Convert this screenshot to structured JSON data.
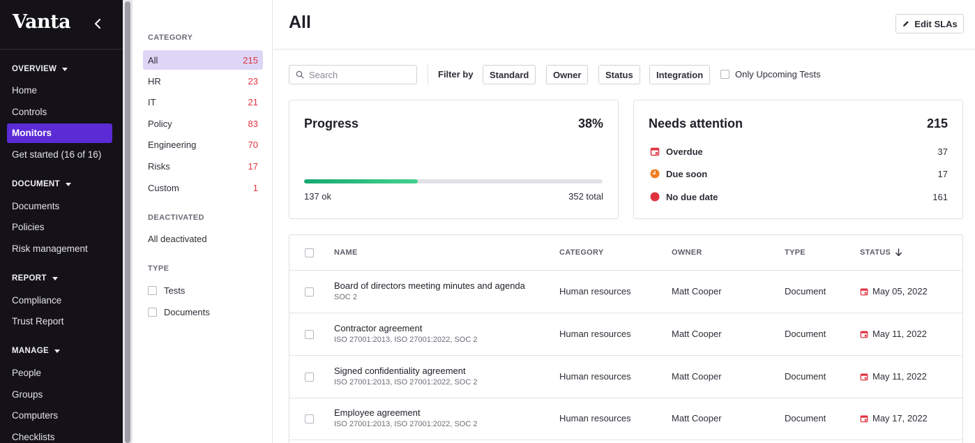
{
  "nav": {
    "brand": "Vanta",
    "sections": [
      {
        "label": "OVERVIEW",
        "items": [
          "Home",
          "Controls",
          "Monitors",
          "Get started (16 of 16)"
        ]
      },
      {
        "label": "DOCUMENT",
        "items": [
          "Documents",
          "Policies",
          "Risk management"
        ]
      },
      {
        "label": "REPORT",
        "items": [
          "Compliance",
          "Trust Report"
        ]
      },
      {
        "label": "MANAGE",
        "items": [
          "People",
          "Groups",
          "Computers",
          "Checklists"
        ]
      }
    ],
    "active_item": "Monitors",
    "accent_color": "#5b2bd6"
  },
  "categories": {
    "heading": "CATEGORY",
    "items": [
      {
        "label": "All",
        "count": "215"
      },
      {
        "label": "HR",
        "count": "23"
      },
      {
        "label": "IT",
        "count": "21"
      },
      {
        "label": "Policy",
        "count": "83"
      },
      {
        "label": "Engineering",
        "count": "70"
      },
      {
        "label": "Risks",
        "count": "17"
      },
      {
        "label": "Custom",
        "count": "1"
      }
    ],
    "deactivated_heading": "DEACTIVATED",
    "deactivated_link": "All deactivated",
    "type_heading": "TYPE",
    "types": [
      "Tests",
      "Documents"
    ]
  },
  "header": {
    "title": "All",
    "edit_button": "Edit SLAs"
  },
  "filters": {
    "search_placeholder": "Search",
    "filter_label": "Filter by",
    "buttons": [
      "Standard",
      "Owner",
      "Status",
      "Integration"
    ],
    "upcoming_label": "Only Upcoming Tests"
  },
  "progress": {
    "title": "Progress",
    "percent_label": "38%",
    "fraction": 0.38,
    "ok_label": "137 ok",
    "total_label": "352 total"
  },
  "attention": {
    "title": "Needs attention",
    "total": "215",
    "rows": [
      {
        "label": "Overdue",
        "count": "37",
        "icon": "overdue-calendar-icon",
        "color": "#e0323f"
      },
      {
        "label": "Due soon",
        "count": "17",
        "icon": "clock-icon",
        "color": "#f07d22"
      },
      {
        "label": "No due date",
        "count": "161",
        "icon": "red-dot-icon",
        "color": "#e0323f"
      }
    ]
  },
  "table": {
    "columns": [
      "NAME",
      "CATEGORY",
      "OWNER",
      "TYPE",
      "STATUS"
    ],
    "rows": [
      {
        "name": "Board of directors meeting minutes and agenda",
        "standards": "SOC 2",
        "category": "Human resources",
        "owner": "Matt Cooper",
        "type": "Document",
        "status": "May 05, 2022"
      },
      {
        "name": "Contractor agreement",
        "standards": "ISO 27001:2013, ISO 27001:2022, SOC 2",
        "category": "Human resources",
        "owner": "Matt Cooper",
        "type": "Document",
        "status": "May 11, 2022"
      },
      {
        "name": "Signed confidentiality agreement",
        "standards": "ISO 27001:2013, ISO 27001:2022, SOC 2",
        "category": "Human resources",
        "owner": "Matt Cooper",
        "type": "Document",
        "status": "May 11, 2022"
      },
      {
        "name": "Employee agreement",
        "standards": "ISO 27001:2013, ISO 27001:2022, SOC 2",
        "category": "Human resources",
        "owner": "Matt Cooper",
        "type": "Document",
        "status": "May 17, 2022"
      }
    ]
  }
}
